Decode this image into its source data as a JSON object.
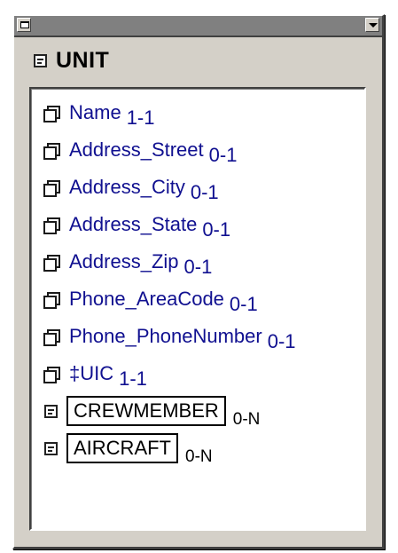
{
  "entity": {
    "title": "UNIT",
    "attributes": [
      {
        "name": "Name",
        "cardinality": "1-1"
      },
      {
        "name": "Address_Street",
        "cardinality": "0-1"
      },
      {
        "name": "Address_City",
        "cardinality": "0-1"
      },
      {
        "name": "Address_State",
        "cardinality": "0-1"
      },
      {
        "name": "Address_Zip",
        "cardinality": "0-1"
      },
      {
        "name": "Phone_AreaCode",
        "cardinality": "0-1"
      },
      {
        "name": "Phone_PhoneNumber",
        "cardinality": "0-1"
      },
      {
        "name": "‡UIC",
        "cardinality": "1-1"
      }
    ],
    "relationships": [
      {
        "name": "CREWMEMBER",
        "cardinality": "0-N"
      },
      {
        "name": "AIRCRAFT",
        "cardinality": "0-N"
      }
    ]
  },
  "icons": {
    "attribute": "attribute-icon",
    "entity": "entity-icon",
    "titlebar_left": "window-menu-icon",
    "titlebar_right": "dropdown-arrow-icon"
  },
  "colors": {
    "attribute_text": "#101090",
    "window_face": "#d4d0c8",
    "titlebar": "#808080"
  }
}
